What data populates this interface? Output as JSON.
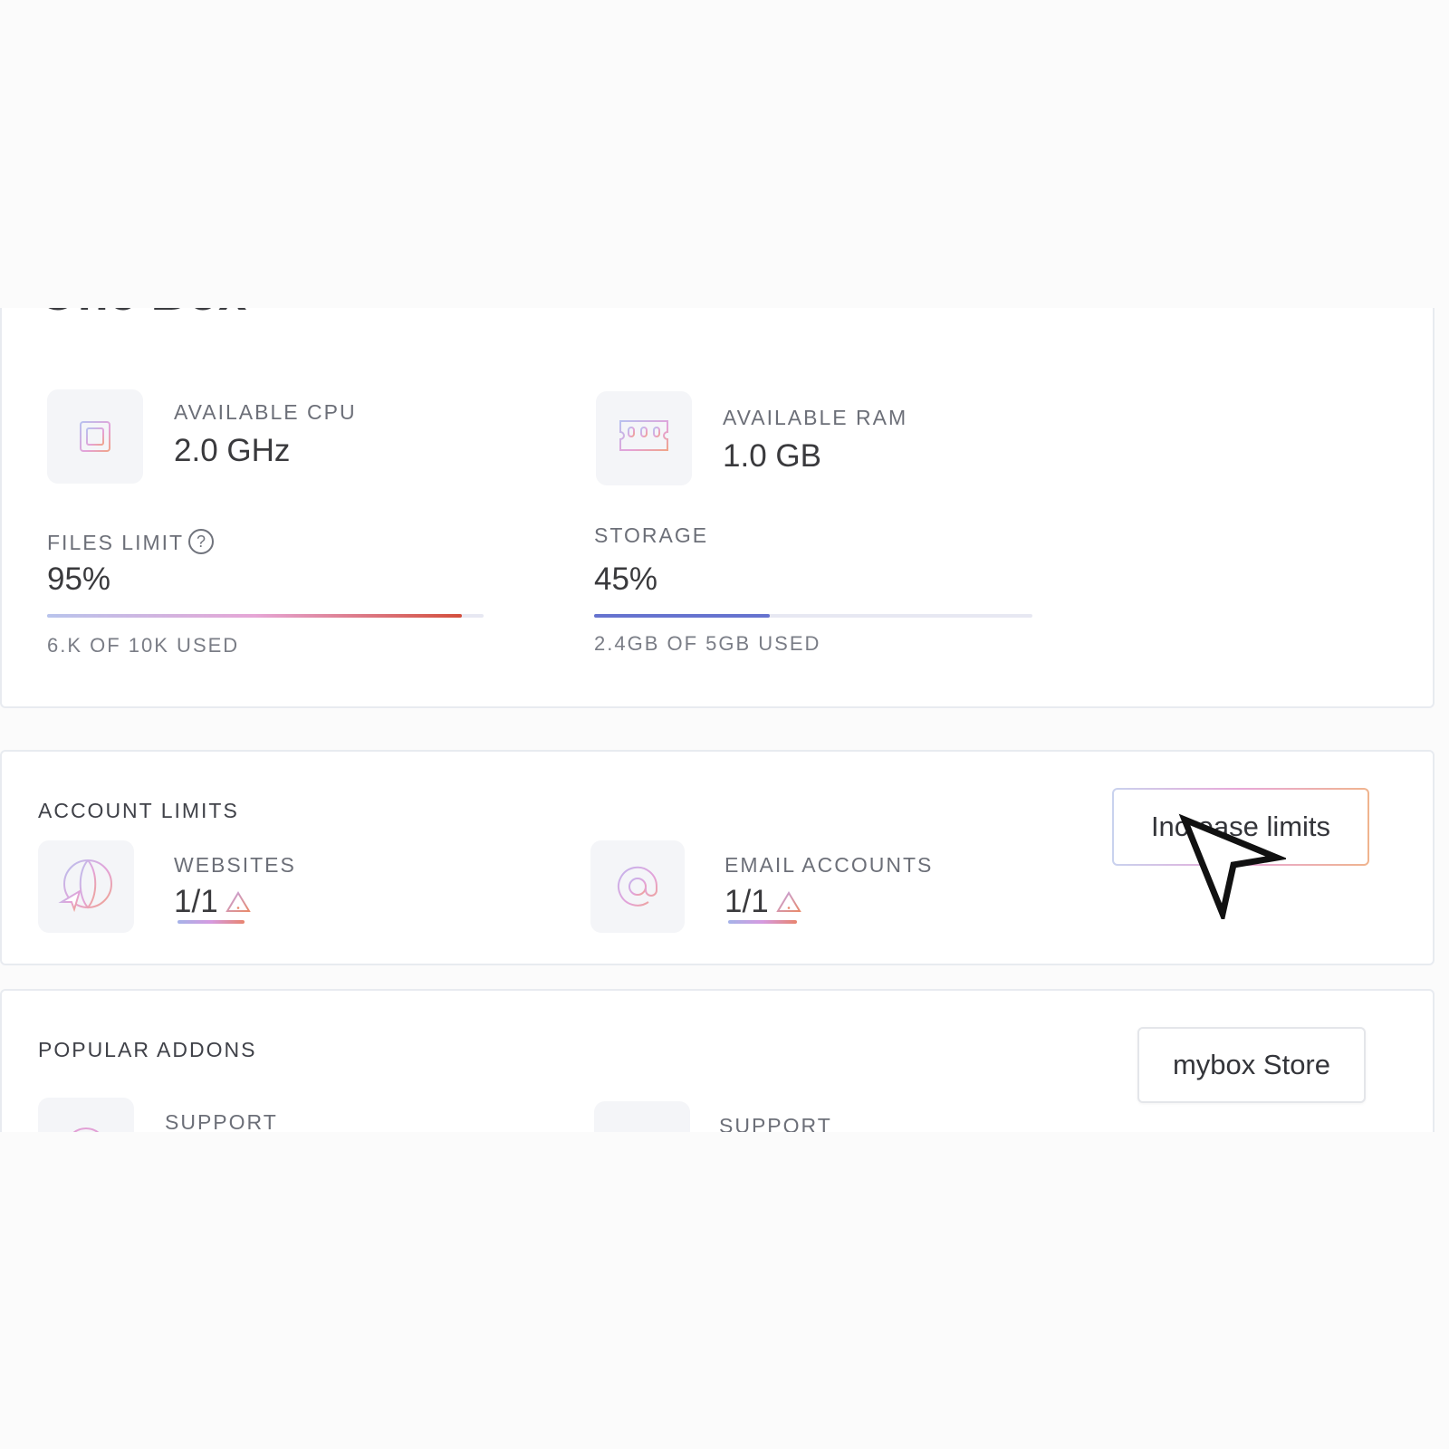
{
  "page": {
    "title": "One Box"
  },
  "resources": {
    "cpu": {
      "label": "AVAILABLE CPU",
      "value": "2.0 GHz",
      "icon": "cpu-chip-icon"
    },
    "ram": {
      "label": "AVAILABLE RAM",
      "value": "1.0 GB",
      "icon": "ram-memory-icon"
    }
  },
  "usage": {
    "files": {
      "label": "FILES LIMIT",
      "help_icon": "?",
      "percent_label": "95%",
      "fill": 0.95,
      "detail": "6.K OF 10K USED",
      "colors": [
        "#b9c4ec",
        "#e6a6d6",
        "#d44f3c"
      ]
    },
    "storage": {
      "label": "STORAGE",
      "percent_label": "45%",
      "fill": 0.4,
      "detail": "2.4GB OF 5GB USED",
      "colors": [
        "#6673cf",
        "#6673cf"
      ]
    }
  },
  "account_limits": {
    "heading": "ACCOUNT LIMITS",
    "button": "Increase limits",
    "websites": {
      "label": "WEBSITES",
      "value": "1/1",
      "icon": "globe-cursor-icon"
    },
    "email": {
      "label": "EMAIL ACCOUNTS",
      "value": "1/1",
      "icon": "at-sign-icon"
    }
  },
  "addons": {
    "heading": "POPULAR ADDONS",
    "button": "mybox Store",
    "items": [
      {
        "label": "SUPPORT"
      },
      {
        "label": "SUPPORT"
      }
    ]
  }
}
